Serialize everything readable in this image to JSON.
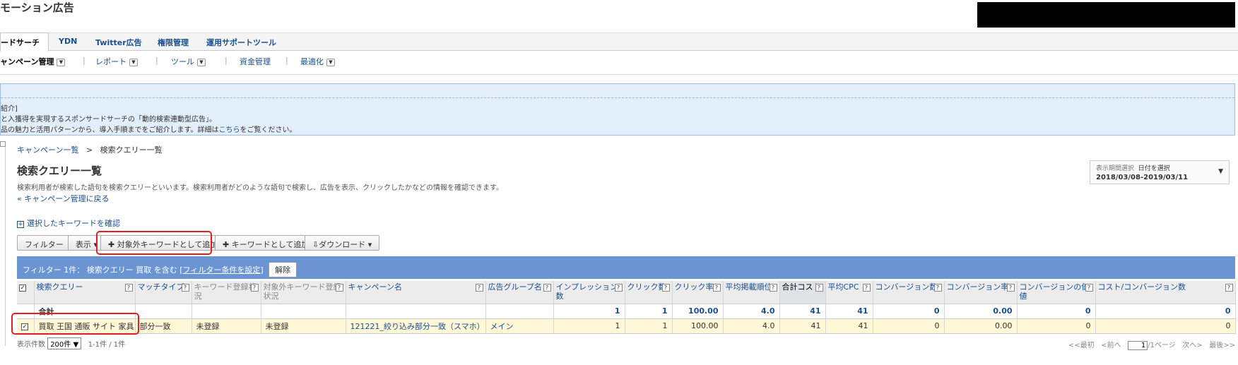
{
  "app": {
    "title": "モーション広告"
  },
  "tabs": [
    "ードサーチ",
    "YDN",
    "Twitter広告",
    "権限管理",
    "運用サポートツール"
  ],
  "subnav": [
    "ャンペーン管理",
    "レポート",
    "ツール",
    "資金管理",
    "最適化"
  ],
  "info": {
    "heading": "紹介]",
    "line1": "と入獲得を実現するスポンサードサーチの「動的検索連動型広告」。",
    "line2_pre": "品の魅力と活用パターンから、導入手順までをご紹介します。詳細は",
    "line2_link": "こちら",
    "line2_post": "をご覧ください。"
  },
  "breadcrumb": {
    "parent": "キャンペーン一覧",
    "sep": ">",
    "current": "検索クエリー一覧"
  },
  "page": {
    "title": "検索クエリー一覧",
    "desc": "検索利用者が検索した語句を検索クエリーといいます。検索利用者がどのような語句で検索し、広告を表示、クリックしたかなどの情報を確認できます。",
    "back": "« キャンペーン管理に戻る"
  },
  "period": {
    "label": "表示期間選択",
    "select": "日付を選択",
    "value": "2018/03/08-2019/03/11"
  },
  "kw_check": "選択したキーワードを確認",
  "toolbar": {
    "filter": "フィルター",
    "display": "表示 ▾",
    "add_negative": "✚ 対象外キーワードとして追加",
    "add_keyword": "✚ キーワードとして追加",
    "download": "⇩ダウンロード ▾"
  },
  "filterbar": {
    "text": "フィルター 1件： 検索クエリー 買取 を含む [",
    "link": "フィルター条件を設定",
    "close": "]",
    "clear": "解除"
  },
  "table": {
    "headers": [
      "検索クエリー",
      "マッチタイプ",
      "キーワード登録状況",
      "対象外キーワード登録状況",
      "キャンペーン名",
      "広告グループ名",
      "インプレッション数",
      "クリック数",
      "クリック率",
      "平均掲載順位",
      "合計コスト",
      "平均CPC",
      "コンバージョン数",
      "コンバージョン率",
      "コンバージョンの価値",
      "コスト/コンバージョン数"
    ],
    "total": [
      "合計",
      "",
      "",
      "",
      "",
      "",
      "1",
      "1",
      "100.00",
      "4.0",
      "41",
      "41",
      "0",
      "0.00",
      "0",
      "0"
    ],
    "rows": [
      [
        "買取 王国 通販 サイト 家具",
        "部分一致",
        "未登録",
        "未登録",
        "121221_絞り込み部分一致（スマホ）",
        "メイン",
        "1",
        "1",
        "100.00",
        "4.0",
        "41",
        "41",
        "0",
        "0.00",
        "0",
        "0"
      ]
    ]
  },
  "footer": {
    "count_label": "表示件数",
    "count_value": "200件 ▼",
    "range": "1-1件 / 1件",
    "first": "<<最初",
    "prev": "<前へ",
    "page": "1",
    "pages": "/1ページ",
    "next": "次へ>",
    "last": "最後>>"
  }
}
